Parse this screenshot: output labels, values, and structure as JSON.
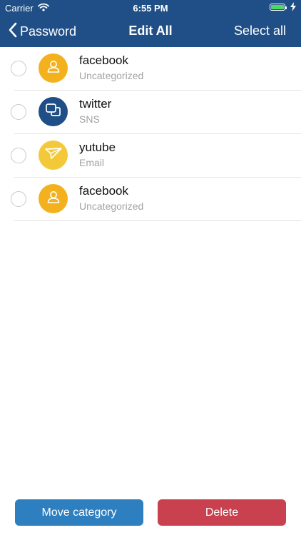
{
  "status_bar": {
    "carrier": "Carrier",
    "time": "6:55 PM",
    "battery_percent": 100,
    "icons": [
      "wifi-icon",
      "battery-icon",
      "charging-bolt-icon"
    ]
  },
  "nav": {
    "back_label": "Password",
    "title": "Edit All",
    "select_all_label": "Select all"
  },
  "items": [
    {
      "title": "facebook",
      "category": "Uncategorized",
      "icon": "person-icon",
      "color": "#f3b21d",
      "selected": false
    },
    {
      "title": "twitter",
      "category": "SNS",
      "icon": "chat-bubbles-icon",
      "color": "#1f4f86",
      "selected": false
    },
    {
      "title": "yutube",
      "category": "Email",
      "icon": "paper-plane-icon",
      "color": "#f3c93a",
      "selected": false
    },
    {
      "title": "facebook",
      "category": "Uncategorized",
      "icon": "person-icon",
      "color": "#f3b21d",
      "selected": false
    }
  ],
  "actions": {
    "move_label": "Move category",
    "delete_label": "Delete"
  },
  "colors": {
    "nav_bar": "#1f4f86",
    "move_button": "#2e7fbf",
    "delete_button": "#c9404f"
  }
}
